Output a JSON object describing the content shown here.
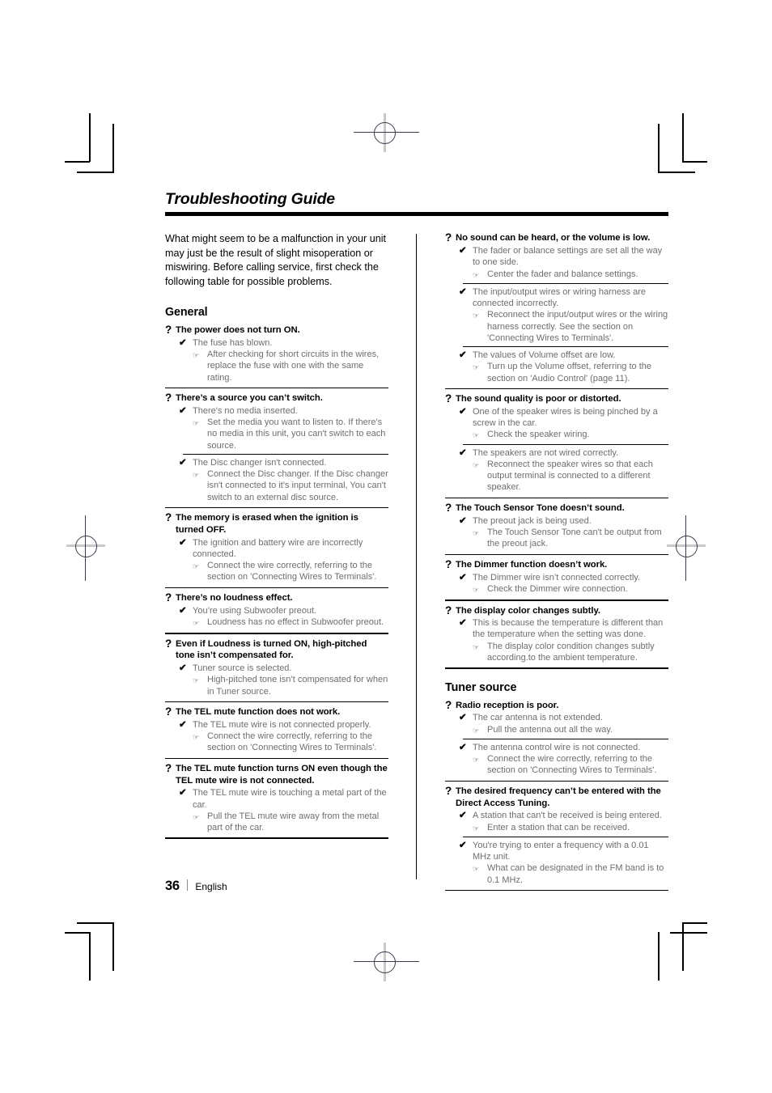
{
  "document": {
    "title": "Troubleshooting Guide",
    "intro": "What might seem to be a malfunction in your unit may just be the result of slight misoperation or miswiring. Before calling service, first check the following table for possible problems.",
    "footer": {
      "page_number": "36",
      "language": "English"
    }
  },
  "glyphs": {
    "question": "?",
    "check": "✔",
    "hand": "☞"
  },
  "left_column": {
    "section_title": "General",
    "problems": [
      {
        "question": "The power does not turn ON.",
        "causes": [
          {
            "cause": "The fuse has blown.",
            "action": "After checking for short circuits in the wires, replace the fuse with one with the same rating."
          }
        ]
      },
      {
        "question": "There’s a source you can’t switch.",
        "causes": [
          {
            "cause": "There's no media inserted.",
            "action": "Set the media you want to listen to. If there's no media in this unit, you can't switch to each source."
          },
          {
            "cause": "The Disc changer isn't connected.",
            "action": "Connect the Disc changer. If the Disc changer isn't connected to it's input terminal, You can't switch to an external disc source."
          }
        ]
      },
      {
        "question": "The memory is erased when the ignition is turned OFF.",
        "causes": [
          {
            "cause": "The ignition and battery wire are incorrectly connected.",
            "action": "Connect the wire correctly, referring to the section on 'Connecting Wires to Terminals'."
          }
        ]
      },
      {
        "question": "There’s no loudness effect.",
        "causes": [
          {
            "cause": "You’re using Subwoofer preout.",
            "action": "Loudness has no effect in Subwoofer preout."
          }
        ]
      },
      {
        "question": "Even if Loudness is turned ON, high-pitched tone isn’t compensated for.",
        "causes": [
          {
            "cause": "Tuner source is selected.",
            "action": "High-pitched tone isn’t compensated for when in Tuner source."
          }
        ]
      },
      {
        "question": "The TEL mute function does not work.",
        "causes": [
          {
            "cause": "The TEL mute wire is not connected properly.",
            "action": "Connect the wire correctly, referring to the section on 'Connecting Wires to Terminals'."
          }
        ]
      },
      {
        "question": "The TEL mute function turns ON even though the TEL mute wire is not connected.",
        "causes": [
          {
            "cause": "The TEL mute wire is touching a metal part of the car.",
            "action": "Pull the TEL mute wire away from the metal part of the car."
          }
        ]
      }
    ]
  },
  "right_column": {
    "problems_top": [
      {
        "question": "No sound can be heard, or the volume is low.",
        "causes": [
          {
            "cause": "The fader or balance settings are set all the way to one side.",
            "action": "Center the fader and balance settings."
          },
          {
            "cause": "The input/output wires or wiring harness are connected incorrectly.",
            "action": "Reconnect the input/output wires or the wiring harness correctly. See the section on 'Connecting Wires to Terminals'."
          },
          {
            "cause": "The values of Volume offset are low.",
            "action": "Turn up the Volume offset, referring to the section on 'Audio Control' (page 11)."
          }
        ]
      },
      {
        "question": "The sound quality is poor or distorted.",
        "causes": [
          {
            "cause": "One of the speaker wires is being pinched by a screw in the car.",
            "action": "Check the speaker wiring."
          },
          {
            "cause": "The speakers are not wired correctly.",
            "action": "Reconnect the speaker wires so that each output terminal is connected to a different speaker."
          }
        ]
      },
      {
        "question": "The Touch Sensor Tone doesn’t sound.",
        "causes": [
          {
            "cause": "The preout jack is being used.",
            "action": "The Touch Sensor Tone can't be output from the preout jack."
          }
        ]
      },
      {
        "question": "The Dimmer function doesn’t work.",
        "causes": [
          {
            "cause": "The Dimmer wire isn’t connected correctly.",
            "action": "Check the Dimmer wire connection."
          }
        ]
      },
      {
        "question": "The display color changes subtly.",
        "causes": [
          {
            "cause": "This is because the temperature is different than the temperature when the setting was done.",
            "action": "The display color condition changes subtly according.to the ambient temperature."
          }
        ]
      }
    ],
    "section_title": "Tuner source",
    "problems_tuner": [
      {
        "question": "Radio reception is poor.",
        "causes": [
          {
            "cause": "The car antenna is not extended.",
            "action": "Pull the antenna out all the way."
          },
          {
            "cause": "The antenna control wire is not connected.",
            "action": "Connect the wire correctly, referring to the section on 'Connecting Wires to Terminals'."
          }
        ]
      },
      {
        "question": "The desired frequency can’t be entered with the Direct Access Tuning.",
        "causes": [
          {
            "cause": "A station that can't be received is being entered.",
            "action": "Enter a station that can be received."
          },
          {
            "cause": "You're trying to enter a frequency with a 0.01 MHz unit.",
            "action": "What can be designated in the FM band is to 0.1 MHz."
          }
        ]
      }
    ]
  }
}
